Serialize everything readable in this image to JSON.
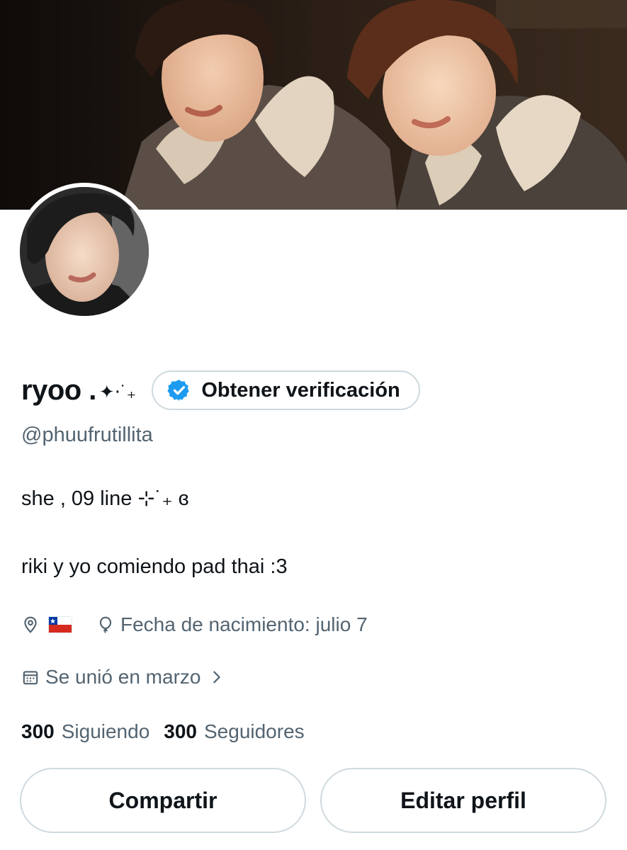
{
  "profile": {
    "display_name": "ryoo .",
    "name_sparkle": "✦⋅˙₊",
    "verify_label": "Obtener verificación",
    "handle": "@phuufrutillita",
    "bio_line1": "she  , 09 line ⊹˙₊ ɞ",
    "bio_line2": "riki y yo comiendo pad thai :3",
    "location_icon": "location-pin-icon",
    "flag": "chile-flag",
    "birthday_label": "Fecha de nacimiento: julio 7",
    "joined_label": "Se unió en marzo",
    "following_count": "300",
    "following_label": "Siguiendo",
    "followers_count": "300",
    "followers_label": "Seguidores"
  },
  "actions": {
    "share_label": "Compartir",
    "edit_label": "Editar perfil"
  },
  "colors": {
    "verified_blue": "#1d9bf0",
    "secondary_text": "#536471",
    "border": "#cfd9de"
  }
}
